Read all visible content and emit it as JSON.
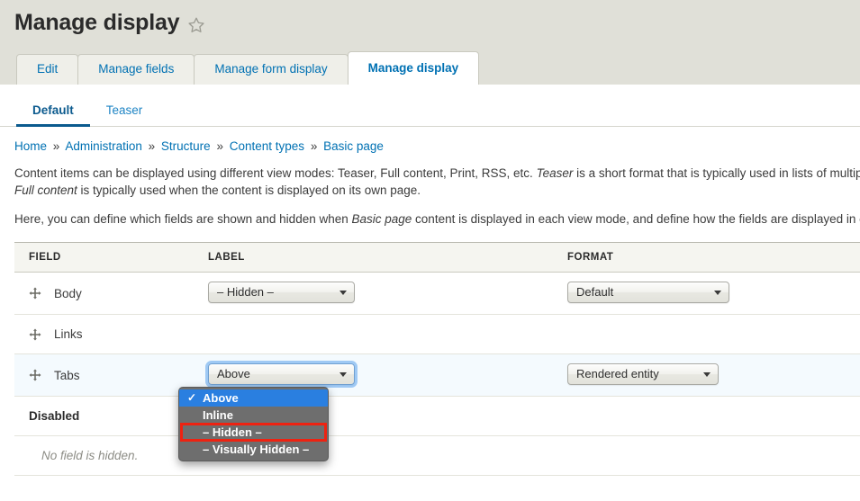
{
  "header": {
    "title": "Manage display",
    "star_icon": "star-outline-icon",
    "primary_tabs": [
      {
        "label": "Edit",
        "active": false
      },
      {
        "label": "Manage fields",
        "active": false
      },
      {
        "label": "Manage form display",
        "active": false
      },
      {
        "label": "Manage display",
        "active": true
      }
    ]
  },
  "secondary_tabs": [
    {
      "label": "Default",
      "active": true
    },
    {
      "label": "Teaser",
      "active": false
    }
  ],
  "breadcrumb": {
    "items": [
      "Home",
      "Administration",
      "Structure",
      "Content types",
      "Basic page"
    ],
    "separator": "»"
  },
  "intro": {
    "p1_a": "Content items can be displayed using different view modes: Teaser, Full content, Print, RSS, etc. ",
    "p1_em": "Teaser",
    "p1_b": " is a short format that is typically used in lists of multiple content items. ",
    "p1_c": "Full content",
    "p1_d": " is typically used when the content is displayed on its own page.",
    "p2_a": "Here, you can define which fields are shown and hidden when ",
    "p2_em": "Basic page",
    "p2_b": " content is displayed in each view mode, and define how the fields are displayed in each view mode."
  },
  "table": {
    "columns": [
      "FIELD",
      "LABEL",
      "FORMAT"
    ],
    "rows": [
      {
        "type": "field",
        "name": "Body",
        "drag_icon": "drag-move-icon",
        "label_select": "– Hidden –",
        "format_select": "Default",
        "highlight": false
      },
      {
        "type": "field",
        "name": "Links",
        "drag_icon": "drag-move-icon",
        "label_select": null,
        "format_select": null,
        "highlight": false
      },
      {
        "type": "field",
        "name": "Tabs",
        "drag_icon": "drag-move-icon",
        "label_select": "Above",
        "format_select": "Rendered entity",
        "highlight": true
      },
      {
        "type": "region",
        "name": "Disabled",
        "highlight": false
      },
      {
        "type": "empty",
        "name": "No field is hidden.",
        "highlight": false
      }
    ]
  },
  "dropdown": {
    "open": true,
    "anchor_row": "Tabs",
    "options": [
      {
        "label": "Above",
        "selected": true,
        "check": "✓",
        "outlined": false
      },
      {
        "label": "Inline",
        "selected": false,
        "check": "",
        "outlined": false
      },
      {
        "label": "– Hidden –",
        "selected": false,
        "check": "",
        "outlined": true
      },
      {
        "label": "– Visually Hidden –",
        "selected": false,
        "check": "",
        "outlined": false
      }
    ],
    "highlight_color": "#ee2211",
    "selected_color": "#2a7fe0",
    "background_color": "#6e6e6e"
  }
}
